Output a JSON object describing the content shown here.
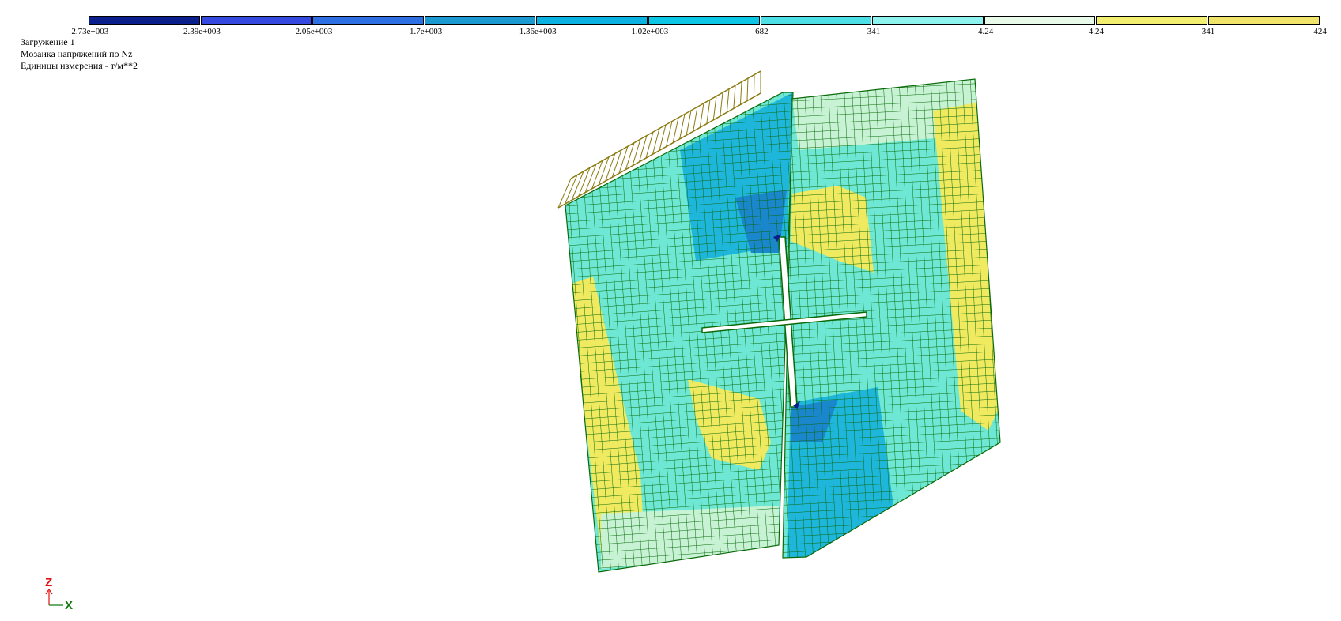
{
  "legend": {
    "ticks": [
      "-2.73e+003",
      "-2.39e+003",
      "-2.05e+003",
      "-1.7e+003",
      "-1.36e+003",
      "-1.02e+003",
      "-682",
      "-341",
      "-4.24",
      "4.24",
      "341",
      "424"
    ],
    "colors": [
      "#0a1e8c",
      "#3548e0",
      "#2f6fe4",
      "#1a9ad0",
      "#0ab2e2",
      "#0cc6e6",
      "#4ddfe6",
      "#8ef3ee",
      "#e8fbe8",
      "#f2ef70",
      "#f0e46a"
    ]
  },
  "info": {
    "line1": "Загружение 1",
    "line2": "Мозаика напряжений по Nz",
    "line3": "Единицы измерения - т/м**2"
  },
  "axes": {
    "z_label": "Z",
    "x_label": "X",
    "z_color": "#e01010",
    "x_color": "#107a10"
  },
  "mesh": {
    "line_color": "#0a6a0a",
    "load_color": "#8a7a10"
  }
}
